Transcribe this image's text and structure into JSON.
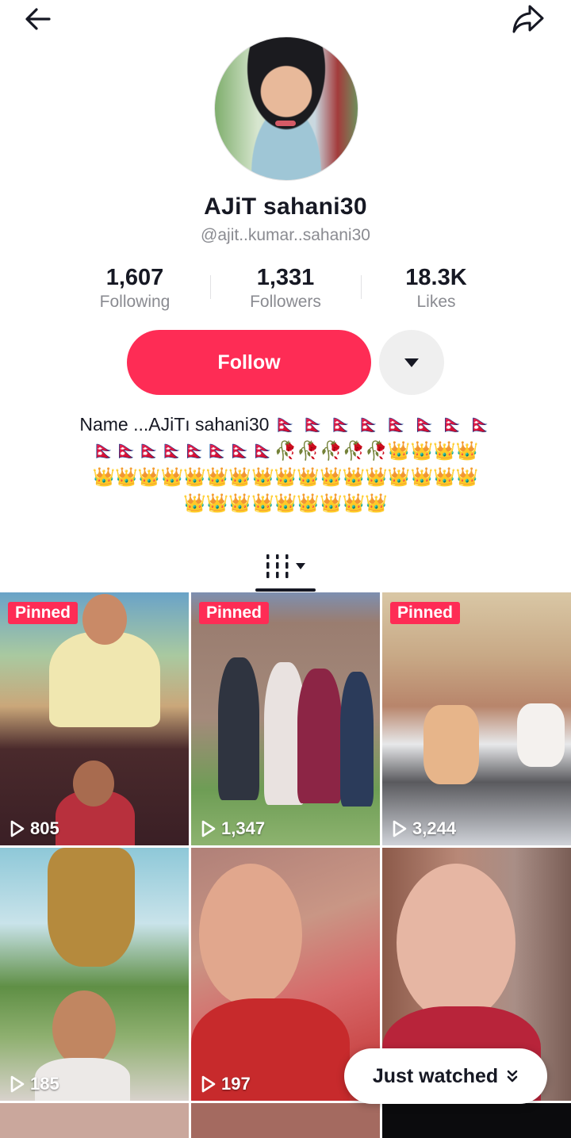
{
  "header": {
    "back_icon": "arrow-left-icon",
    "share_icon": "share-arrow-icon"
  },
  "profile": {
    "display_name": "AJiT sahani30",
    "username": "@ajit..kumar..sahani30",
    "stats": [
      {
        "value": "1,607",
        "label": "Following"
      },
      {
        "value": "1,331",
        "label": "Followers"
      },
      {
        "value": "18.3K",
        "label": "Likes"
      }
    ],
    "follow_label": "Follow",
    "more_icon": "caret-down-icon",
    "bio_line1": "Name  ...AJiTı  sahani30 🇳🇵 🇳🇵 🇳🇵 🇳🇵 🇳🇵 🇳🇵 🇳🇵 🇳🇵",
    "bio_line2": "🇳🇵🇳🇵🇳🇵🇳🇵🇳🇵🇳🇵🇳🇵🇳🇵🥀🥀🥀🥀🥀👑👑👑👑",
    "bio_line3": "👑👑👑👑👑👑👑👑👑👑👑👑👑👑👑👑👑",
    "bio_line4": "👑👑👑👑👑👑👑👑👑"
  },
  "tabs": {
    "grid_icon": "videos-grid-icon",
    "dropdown_icon": "triangle-down-icon"
  },
  "videos": [
    {
      "pinned": "Pinned",
      "views": "805"
    },
    {
      "pinned": "Pinned",
      "views": "1,347"
    },
    {
      "pinned": "Pinned",
      "views": "3,244"
    },
    {
      "views": "185"
    },
    {
      "views": "197"
    },
    {
      "views": ""
    }
  ],
  "just_watched": {
    "label": "Just watched",
    "icon": "double-chevron-down-icon"
  },
  "colors": {
    "accent": "#fe2c55",
    "text": "#161823",
    "secondary": "#8a8b91"
  }
}
